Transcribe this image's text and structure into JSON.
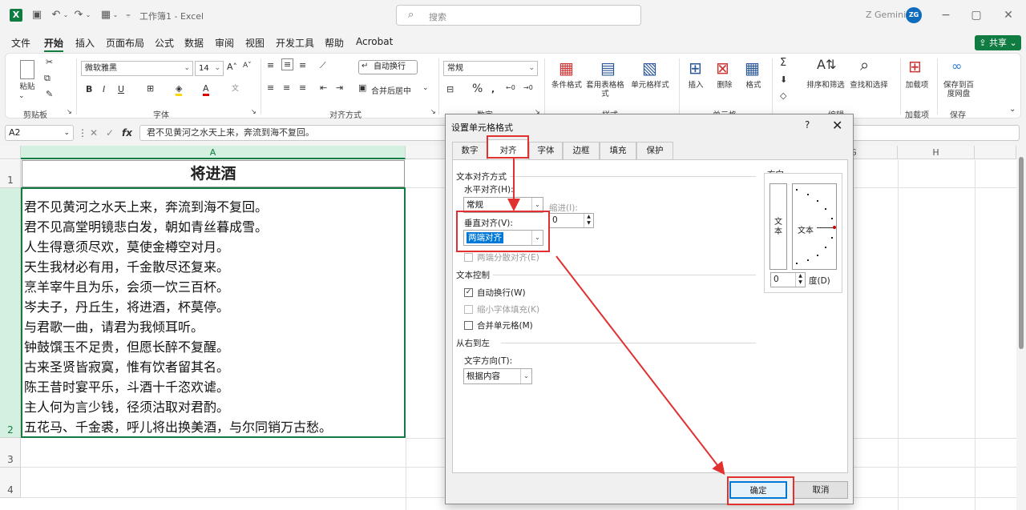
{
  "titlebar": {
    "app_icon": "X",
    "doc_title": "工作簿1 - Excel",
    "search_placeholder": "搜索",
    "user_name": "Z Gemini",
    "user_initials": "ZG"
  },
  "menu": {
    "items": [
      "文件",
      "开始",
      "插入",
      "页面布局",
      "公式",
      "数据",
      "审阅",
      "视图",
      "开发工具",
      "帮助",
      "Acrobat"
    ],
    "active": "开始",
    "share_label": "共享"
  },
  "ribbon": {
    "paste_label": "粘贴",
    "clipboard_label": "剪贴板",
    "font_name": "微软雅黑",
    "font_size": "14",
    "font_group_label": "字体",
    "wrap_text_label": "自动换行",
    "merge_center_label": "合并后居中",
    "align_group_label": "对齐方式",
    "number_format": "常规",
    "number_group_label": "数字",
    "cond_format_label": "条件格式",
    "table_format_label": "套用表格格式",
    "cell_style_label": "单元格样式",
    "styles_group_label": "样式",
    "insert_label": "插入",
    "delete_label": "删除",
    "format_label": "格式",
    "cells_group_label": "单元格",
    "sort_filter_label": "排序和筛选",
    "find_select_label": "查找和选择",
    "edit_group_label": "编辑",
    "addins_label": "加载项",
    "addins_group_label": "加载项",
    "save_baidu_label": "保存到百度网盘",
    "save_group_label": "保存"
  },
  "formula_bar": {
    "name_box": "A2",
    "formula": "君不见黄河之水天上来，奔流到海不复回。"
  },
  "sheet": {
    "columns": [
      "A",
      "",
      "G",
      "H"
    ],
    "rows": [
      "1",
      "2",
      "3",
      "4"
    ],
    "a1": "将进酒",
    "poem_lines": [
      "君不见黄河之水天上来，奔流到海不复回。",
      "君不见高堂明镜悲白发，朝如青丝暮成雪。",
      "人生得意须尽欢，莫使金樽空对月。",
      "天生我材必有用，千金散尽还复来。",
      "烹羊宰牛且为乐，会须一饮三百杯。",
      "岑夫子，丹丘生，将进酒，杯莫停。",
      "与君歌一曲，请君为我倾耳听。",
      "钟鼓馔玉不足贵，但愿长醉不复醒。",
      "古来圣贤皆寂寞，惟有饮者留其名。",
      "陈王昔时宴平乐，斗酒十千恣欢谑。",
      "主人何为言少钱，径须沽取对君酌。",
      "五花马、千金裘，呼儿将出换美酒，与尔同销万古愁。"
    ]
  },
  "dialog": {
    "title": "设置单元格格式",
    "help": "?",
    "close": "✕",
    "tabs": [
      "数字",
      "对齐",
      "字体",
      "边框",
      "填充",
      "保护"
    ],
    "active_tab": "对齐",
    "text_align_section": "文本对齐方式",
    "horizontal_label": "水平对齐(H):",
    "horizontal_value": "常规",
    "indent_label": "缩进(I):",
    "indent_value": "0",
    "vertical_label": "垂直对齐(V):",
    "vertical_value": "两端对齐",
    "distributed_label": "两端分散对齐(E)",
    "text_control_section": "文本控制",
    "wrap_label": "自动换行(W)",
    "wrap_checked": true,
    "shrink_label": "缩小字体填充(K)",
    "merge_label": "合并单元格(M)",
    "rtl_section": "从右到左",
    "text_dir_label": "文字方向(T):",
    "text_dir_value": "根据内容",
    "orientation_label": "方向",
    "vertical_text": "文本",
    "dial_text": "文本",
    "degree_value": "0",
    "degree_label": "度(D)",
    "ok_label": "确定",
    "cancel_label": "取消"
  },
  "annotation_color": "#e03030"
}
